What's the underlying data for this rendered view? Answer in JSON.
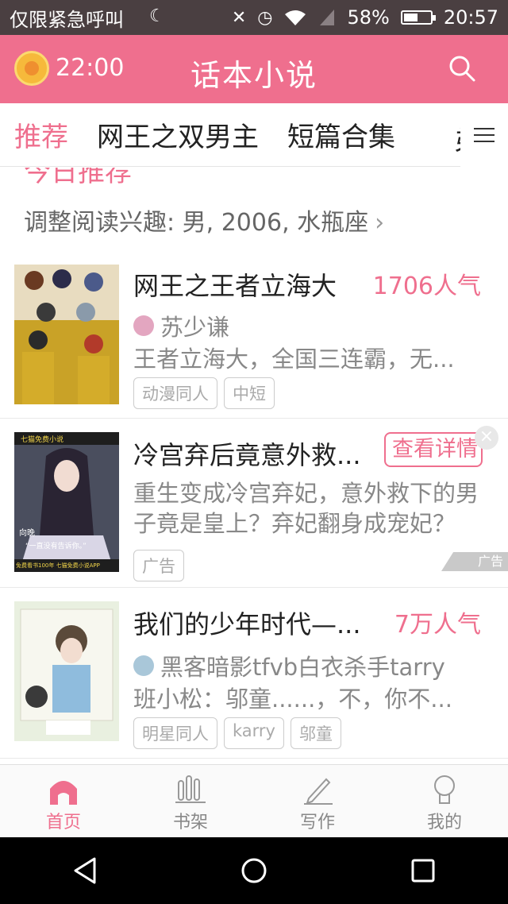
{
  "status_bar": {
    "carrier": "仅限紧急呼叫",
    "battery_percent": "58%",
    "battery_level": 0.58,
    "time": "20:57"
  },
  "header": {
    "alarm_time": "22:00",
    "title": "话本小说",
    "search_icon": "search-icon"
  },
  "tabs": [
    {
      "label": "推荐",
      "active": true
    },
    {
      "label": "网王之双男主",
      "active": false
    },
    {
      "label": "短篇合集",
      "active": false
    },
    {
      "label": "弟",
      "active": false
    }
  ],
  "section": {
    "heading": "今日推荐",
    "interest_label": "调整阅读兴趣: 男, 2006, 水瓶座"
  },
  "books": [
    {
      "title": "网王之王者立海大",
      "popularity": "1706人气",
      "author": "苏少谦",
      "description": "王者立海大，全国三连霸，无...",
      "tags": [
        "动漫同人",
        "中短"
      ]
    },
    {
      "title": "我们的少年时代—...",
      "popularity": "7万人气",
      "author": "黑客暗影tfvb白衣杀手tarry",
      "description": "班小松：邬童......，不，你不...",
      "tags": [
        "明星同人",
        "karry",
        "邬童"
      ]
    }
  ],
  "ad": {
    "title": "冷宫弃后竟意外救...",
    "detail_button": "查看详情",
    "description": "重生变成冷宫弃妃，意外救下的男子竟是皇上？弃妃翻身成宠妃？",
    "tag": "广告",
    "corner_label": "广告",
    "cover_brand": "七猫免费小说",
    "cover_name": "向晚",
    "cover_quote": "“一直没有告诉你。”",
    "cover_footer": "免费看书100年  七猫免费小说APP"
  },
  "bottom_nav": [
    {
      "label": "首页",
      "icon": "home-icon",
      "active": true
    },
    {
      "label": "书架",
      "icon": "bookshelf-icon",
      "active": false
    },
    {
      "label": "写作",
      "icon": "pencil-icon",
      "active": false
    },
    {
      "label": "我的",
      "icon": "profile-icon",
      "active": false
    }
  ],
  "colors": {
    "accent": "#ef6f8e",
    "status_bar": "#4a3f41"
  }
}
